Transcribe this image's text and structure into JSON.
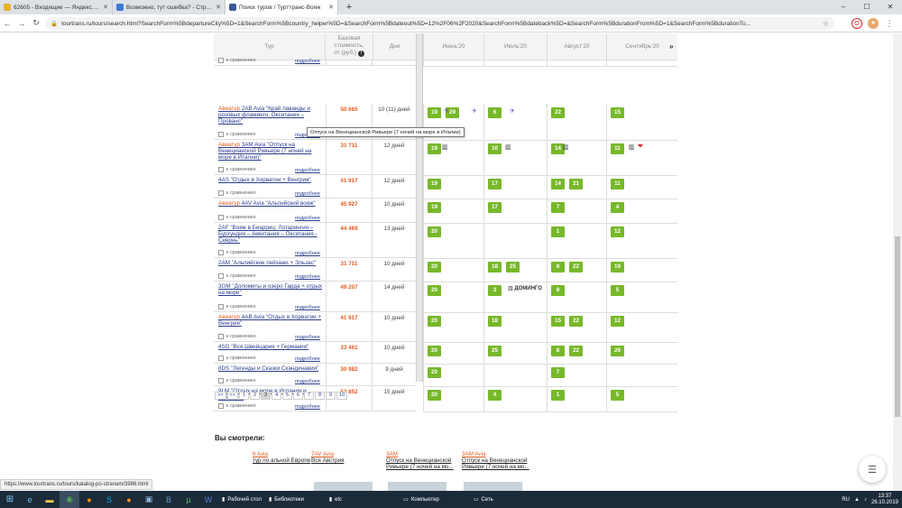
{
  "browser": {
    "tabs": [
      {
        "title": "62605 - Входящие — Яндекс.Почта",
        "favicon_color": "#e8b22e",
        "active": false
      },
      {
        "title": "Возможно, тут ошибка? - Страна",
        "favicon_color": "#3a7bd5",
        "active": false
      },
      {
        "title": "Поиск туров / Турттранс-Вояж",
        "favicon_color": "#3b5998",
        "active": true
      }
    ],
    "new_tab": "+",
    "window_controls": [
      "–",
      "☐",
      "✕"
    ],
    "url": "tourtrans.ru/tours/search.html?SearchForm%5BdepartureCity%5D=1&SearchForm%5Bcountry_helper%5D=&SearchForm%5Bdateout%5D=12%2F06%2F2020&SearchForm%5Bdateback%5D=&SearchForm%5BdurationFrom%5D=1&SearchForm%5BdurationTo..."
  },
  "table": {
    "headers": {
      "tour": "Тур",
      "price_line1": "Базовая",
      "price_line2": "стоимость,",
      "price_line3": "от (руб.)",
      "days": "Дни",
      "months": [
        "Июнь'20",
        "Июль'20",
        "Август'20",
        "Сентябрь'20"
      ],
      "more": "»"
    },
    "compare_label": "к сравнению",
    "more_label": "подробнее",
    "rows": [
      {
        "operator": "",
        "name": "",
        "price": "",
        "days": "",
        "dates": [
          [],
          [],
          [],
          []
        ]
      },
      {
        "operator": "Авиатур",
        "name": "2AB Avia \"Край лаванды и розовых фламинго. Окситания – Прованс\"",
        "price": "50 665",
        "days": "10 (11) дней",
        "dates": [
          [
            "19",
            "29"
          ],
          [
            "6"
          ],
          [
            "22"
          ],
          [
            "15"
          ]
        ]
      },
      {
        "operator": "Авиатур",
        "name": "3AM Avia \"Отпуск на Венецианской Ривьере (7 ночей на море в Италии)\"",
        "price": "31 711",
        "days": "12 дней",
        "dates": [
          [
            "19"
          ],
          [
            "10"
          ],
          [
            "14"
          ],
          [
            "11"
          ]
        ]
      },
      {
        "operator": "",
        "name": "4AS \"Отдых в Хорватии + Венгрия\"",
        "price": "41 917",
        "days": "12 дней",
        "dates": [
          [
            "19"
          ],
          [
            "17"
          ],
          [
            "14",
            "21"
          ],
          [
            "11"
          ]
        ]
      },
      {
        "operator": "Авиатур",
        "name": "4AV Avia \"Альпийский вояж\"",
        "price": "45 927",
        "days": "10 дней",
        "dates": [
          [
            "19"
          ],
          [
            "17"
          ],
          [
            "7"
          ],
          [
            "4"
          ]
        ]
      },
      {
        "operator": "",
        "name": "2AF \"Вояж в Биарриц: Лотарингия – Бургундия – Аквитания – Окситания - Севрнь\"",
        "price": "44 469",
        "days": "13 дней",
        "dates": [
          [
            "20"
          ],
          [],
          [
            "1"
          ],
          [
            "12"
          ]
        ]
      },
      {
        "operator": "",
        "name": "2AM \"Альпийские пейзажи + Эльзас\"",
        "price": "31 711",
        "days": "10 дней",
        "dates": [
          [
            "20"
          ],
          [
            "18",
            "25"
          ],
          [
            "8",
            "22"
          ],
          [
            "19"
          ]
        ]
      },
      {
        "operator": "",
        "name": "3GM \"Доломиты и озеро Гарда + отдых на море\"",
        "price": "49 207",
        "days": "14 дней",
        "dates": [
          [
            "20"
          ],
          [
            "3"
          ],
          [
            "8"
          ],
          [
            "5"
          ]
        ]
      },
      {
        "operator": "Авиатур",
        "name": "4AB Avia \"Отдых в Хорватии + Венгрия\"",
        "price": "41 917",
        "days": "10 дней",
        "dates": [
          [
            "20"
          ],
          [
            "18"
          ],
          [
            "15",
            "22"
          ],
          [
            "12"
          ]
        ]
      },
      {
        "operator": "",
        "name": "4SG \"Вся Швейцария + Германия\"",
        "price": "33 461",
        "days": "10 дней",
        "dates": [
          [
            "20"
          ],
          [
            "25"
          ],
          [
            "8",
            "22"
          ],
          [
            "26"
          ]
        ]
      },
      {
        "operator": "",
        "name": "8DS \"Легенды и Сказки Скандинавии\"",
        "price": "30 982",
        "days": "9 дней",
        "dates": [
          [
            "20"
          ],
          [],
          [
            "7"
          ],
          []
        ]
      },
      {
        "operator": "",
        "name": "9LM \"Отдых на море в Испании и Франции\"",
        "price": "52 852",
        "days": "15 дней",
        "dates": [
          [
            "20"
          ],
          [
            "4"
          ],
          [
            "1"
          ],
          [
            "5"
          ]
        ]
      }
    ],
    "dolomiti_note": "ДОМИНГО",
    "tooltip": "Отпуск на Венецианской Ривьере (7 ночей на море в Италии)"
  },
  "pager": [
    ">>",
    "<<",
    "1",
    "2",
    "3",
    "4",
    "5",
    "6",
    "7",
    "8",
    "9",
    "10"
  ],
  "pager_current": "3",
  "seen": {
    "title": "Вы смотрели:",
    "items": [
      {
        "op": "6 Avia",
        "name": "тур по альной Европе"
      },
      {
        "op": "7AV Avia",
        "name": "Вся Австрия"
      },
      {
        "op": "3AM",
        "name": "Отпуск на Венецианской Ривьере (7 ночей на мо..."
      },
      {
        "op": "3AM Avia",
        "name": "Отпуск на Венецианской Ривьере (7 ночей на мо..."
      }
    ]
  },
  "status_url": "https://www.tourtrans.ru/tours/katalog-po-stranam/3986.html",
  "taskbar": {
    "windows": [
      "Рабочий стол",
      "Библиотеки",
      "etc",
      "Компьютер",
      "Сеть"
    ],
    "lang": "RU",
    "time": "13:37",
    "date": "26.10.2019"
  }
}
